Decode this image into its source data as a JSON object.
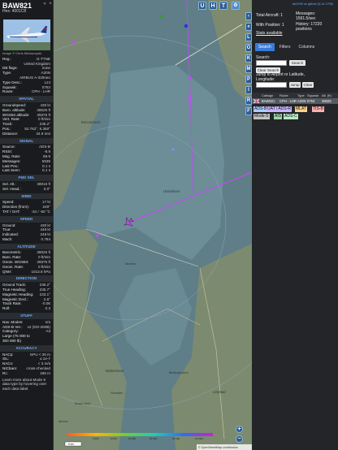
{
  "aircraft": {
    "callsign": "BAW821",
    "hex_label": "Hex: 4001C8",
    "image_credit": "Image © Chris Michaczyski",
    "basic": [
      {
        "k": "Reg.:",
        "v": "G-TTNE"
      },
      {
        "k": "",
        "v": "United Kingdom"
      },
      {
        "k": "DB flags:",
        "v": "none"
      },
      {
        "k": "Type:",
        "v": "A20N"
      },
      {
        "k": "",
        "v": "AIRBUS A-320neo"
      },
      {
        "k": "Type Desc.:",
        "v": "L2J"
      },
      {
        "k": "Squawk:",
        "v": "0753"
      },
      {
        "k": "Route:",
        "v": "CPH - LHR"
      }
    ],
    "sections": [
      {
        "title": "SPATIAL",
        "rows": [
          {
            "k": "Groundspeed:",
            "v": "430 kt"
          },
          {
            "k": "Baro. altitude:",
            "v": "38025 ft"
          },
          {
            "k": "WGS84 altitude:",
            "v": "39375 ft"
          },
          {
            "k": "Vert. Rate:",
            "v": "0 ft/min"
          },
          {
            "k": "Track:",
            "v": "235.2°"
          },
          {
            "k": "Pos.:",
            "v": "52.762°, 5.350°"
          },
          {
            "k": "Distance:",
            "v": "34.9 nmi"
          }
        ]
      },
      {
        "title": "SIGNAL",
        "rows": [
          {
            "k": "Source:",
            "v": "ADS-B"
          },
          {
            "k": "RSSI:",
            "v": "-8.9"
          },
          {
            "k": "Msg. Rate:",
            "v": "89.9"
          },
          {
            "k": "Messages:",
            "v": "5538"
          },
          {
            "k": "",
            "v": ""
          },
          {
            "k": "Last Pos.:",
            "v": "0.1 s"
          },
          {
            "k": "Last Seen:",
            "v": "0.1 s"
          }
        ]
      },
      {
        "title": "FMS SEL",
        "rows": [
          {
            "k": "Sel. Alt.:",
            "v": "38016 ft"
          },
          {
            "k": "Sel. Head.:",
            "v": "0.0°"
          }
        ]
      },
      {
        "title": "WIND",
        "rows": [
          {
            "k": "Speed:",
            "v": "17 kt"
          },
          {
            "k": "Direction (from):",
            "v": "249°"
          },
          {
            "k": "TAT / OAT:",
            "v": "-34 / -60 °C"
          }
        ]
      },
      {
        "title": "SPEED",
        "rows": [
          {
            "k": "Ground:",
            "v": "430 kt"
          },
          {
            "k": "True:",
            "v": "446 kt"
          },
          {
            "k": "Indicated:",
            "v": "248 kt"
          },
          {
            "k": "Mach:",
            "v": "0.784"
          }
        ]
      },
      {
        "title": "ALTITUDE",
        "rows": [
          {
            "k": "Barometric:",
            "v": "38025 ft"
          },
          {
            "k": "Baro. Rate:",
            "v": "0 ft/min"
          },
          {
            "k": "Geom. WGS84:",
            "v": "39375 ft"
          },
          {
            "k": "Geom. Rate:",
            "v": "0 ft/min"
          },
          {
            "k": "QNH:",
            "v": "1013.6 hPa"
          }
        ]
      },
      {
        "title": "DIRECTION",
        "rows": [
          {
            "k": "Ground Track:",
            "v": "235.2°"
          },
          {
            "k": "True Heading:",
            "v": "235.7°"
          },
          {
            "k": "Magnetic Heading:",
            "v": "233.1°"
          },
          {
            "k": "Magnetic Decl.:",
            "v": "2.6°"
          },
          {
            "k": "Track Rate:",
            "v": "-0.06"
          },
          {
            "k": "Roll:",
            "v": "0.3"
          }
        ]
      },
      {
        "title": "STUFF",
        "rows": [
          {
            "k": "Nav. Modes:",
            "v": "n/a"
          },
          {
            "k": "ADS-B Ver.:",
            "v": "v2 (DO-260B)"
          },
          {
            "k": "Category:",
            "v": "A3"
          },
          {
            "k": "Large (75 000 to",
            "v": ""
          },
          {
            "k": "300 000 lb)",
            "v": ""
          }
        ]
      },
      {
        "title": "ACCURACY",
        "rows": [
          {
            "k": "NACp:",
            "v": "EPU < 30 m"
          },
          {
            "k": "SIL:",
            "v": "≤ 1e-7"
          },
          {
            "k": "NACv:",
            "v": "< 3 m/s"
          },
          {
            "k": "NICbaro:",
            "v": "cross-checked"
          },
          {
            "k": "Rc:",
            "v": "186 m"
          }
        ]
      }
    ],
    "footer": "Learn more about Mode S data type by hovering over each data label."
  },
  "map": {
    "labels": {
      "city1": "Brecomtreck",
      "city2": "IJsselmeer",
      "city3": "Marken",
      "city4": "Markermeer",
      "city5": "Stroeden",
      "city6": "Lelystad",
      "city7": "Biddinghuizen",
      "city8": "Almere",
      "city9": "Bosso Veld"
    },
    "attribution": "© OpenStreetMap contributors",
    "scale_label": "5 km",
    "top_buttons": [
      "U",
      "H",
      "T"
    ],
    "side_buttons": [
      "L",
      "O",
      "K",
      "M",
      "P",
      "I",
      "R",
      "F"
    ],
    "alt_scale": [
      "6 000",
      "8 000",
      "10 000",
      "20 000",
      "30 000",
      "40 000+"
    ],
    "colors": {
      "track": "#cc44ff",
      "land": "#7c8a6e",
      "water": "#5f7e88"
    }
  },
  "stats": {
    "link": "tar1090 on github (3.14.1795)",
    "total_aircraft": "Total Aircraft: 1",
    "with_position": "With Position: 1",
    "messages_label": "Messages:",
    "messages_value": "1591.5/sec",
    "history_label": "History: 17220",
    "history_value": "positions",
    "stats_available": "Stats available"
  },
  "right_panel": {
    "tabs": [
      "Search",
      "Filters",
      "Columns"
    ],
    "search_label": "Search:",
    "search_button": "Search",
    "clear_search": "Clear Search",
    "jump_label": "Jump to Airport or Latitude, Longitude:",
    "jump_button": "Jump",
    "clear_button": "Clear",
    "table_headers": [
      "Callsign",
      "Route",
      "Type",
      "Squawk",
      "Alt. (ft)"
    ],
    "table_row": [
      "BAW821",
      "CPH - LHR",
      "A20N",
      "0753",
      "38025"
    ],
    "legend": [
      {
        "label": "ADS-B",
        "color": "#aecbff"
      },
      {
        "label": "UAT / ADS-R",
        "color": "#c7b6ff"
      },
      {
        "label": "MLAT",
        "color": "#ffd28a"
      },
      {
        "label": "TIS-B",
        "color": "#ffb0b0"
      },
      {
        "label": "Mode-S",
        "color": "#c2c2c2"
      },
      {
        "label": "AIS",
        "color": "#9fd6a8"
      },
      {
        "label": "ADS-C",
        "color": "#b8e8c4"
      }
    ]
  }
}
